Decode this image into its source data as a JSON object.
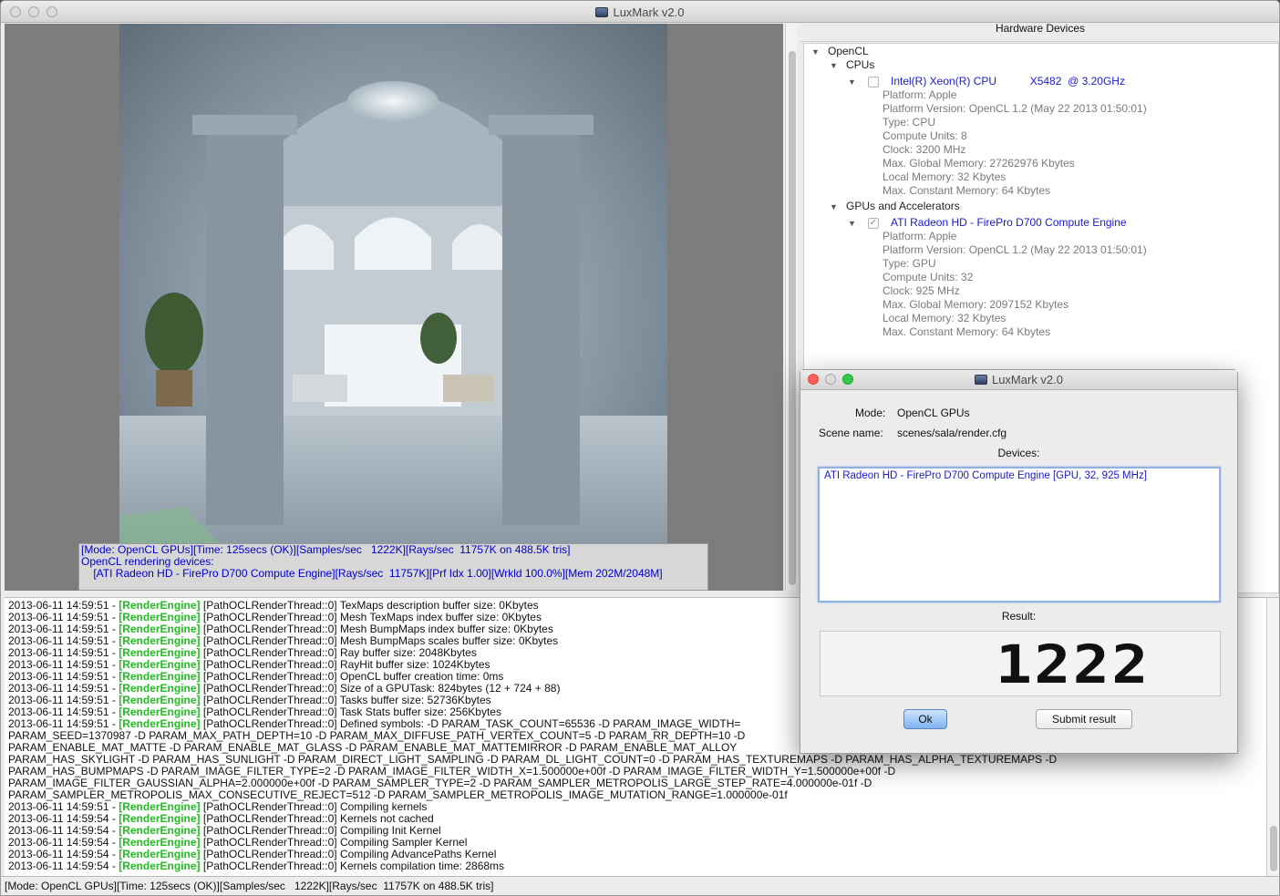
{
  "window": {
    "title": "LuxMark v2.0"
  },
  "render": {
    "overlay_line1": "[Mode: OpenCL GPUs][Time: 125secs (OK)][Samples/sec   1222K][Rays/sec  11757K on 488.5K tris]",
    "overlay_line2": "",
    "overlay_line3": "OpenCL rendering devices:",
    "overlay_line4": "    [ATI Radeon HD - FirePro D700 Compute Engine][Rays/sec  11757K][Prf Idx 1.00][Wrkld 100.0%][Mem 202M/2048M]"
  },
  "hardware": {
    "header": "Hardware Devices",
    "opencl": "OpenCL",
    "cpus": "CPUs",
    "cpu_device": {
      "name": "Intel(R) Xeon(R) CPU           X5482  @ 3.20GHz",
      "checked": false,
      "info": [
        "Platform: Apple",
        "Platform Version: OpenCL 1.2 (May 22 2013 01:50:01)",
        "Type: CPU",
        "Compute Units: 8",
        "Clock: 3200 MHz",
        "Max. Global Memory: 27262976 Kbytes",
        "Local Memory: 32 Kbytes",
        "Max. Constant Memory: 64 Kbytes"
      ]
    },
    "gpus": "GPUs and Accelerators",
    "gpu_device": {
      "name": "ATI Radeon HD - FirePro D700 Compute Engine",
      "checked": true,
      "info": [
        "Platform: Apple",
        "Platform Version: OpenCL 1.2 (May 22 2013 01:50:01)",
        "Type: GPU",
        "Compute Units: 32",
        "Clock: 925 MHz",
        "Max. Global Memory: 2097152 Kbytes",
        "Local Memory: 32 Kbytes",
        "Max. Constant Memory: 64 Kbytes"
      ]
    }
  },
  "log": [
    {
      "ts": "2013-06-11 14:59:51 - ",
      "tag": "[RenderEngine]",
      "msg": " [PathOCLRenderThread::0] TexMaps description buffer size: 0Kbytes"
    },
    {
      "ts": "2013-06-11 14:59:51 - ",
      "tag": "[RenderEngine]",
      "msg": " [PathOCLRenderThread::0] Mesh TexMaps index buffer size: 0Kbytes"
    },
    {
      "ts": "2013-06-11 14:59:51 - ",
      "tag": "[RenderEngine]",
      "msg": " [PathOCLRenderThread::0] Mesh BumpMaps index buffer size: 0Kbytes"
    },
    {
      "ts": "2013-06-11 14:59:51 - ",
      "tag": "[RenderEngine]",
      "msg": " [PathOCLRenderThread::0] Mesh BumpMaps scales buffer size: 0Kbytes"
    },
    {
      "ts": "2013-06-11 14:59:51 - ",
      "tag": "[RenderEngine]",
      "msg": " [PathOCLRenderThread::0] Ray buffer size: 2048Kbytes"
    },
    {
      "ts": "2013-06-11 14:59:51 - ",
      "tag": "[RenderEngine]",
      "msg": " [PathOCLRenderThread::0] RayHit buffer size: 1024Kbytes"
    },
    {
      "ts": "2013-06-11 14:59:51 - ",
      "tag": "[RenderEngine]",
      "msg": " [PathOCLRenderThread::0] OpenCL buffer creation time: 0ms"
    },
    {
      "ts": "2013-06-11 14:59:51 - ",
      "tag": "[RenderEngine]",
      "msg": " [PathOCLRenderThread::0] Size of a GPUTask: 824bytes (12 + 724 + 88)"
    },
    {
      "ts": "2013-06-11 14:59:51 - ",
      "tag": "[RenderEngine]",
      "msg": " [PathOCLRenderThread::0] Tasks buffer size: 52736Kbytes"
    },
    {
      "ts": "2013-06-11 14:59:51 - ",
      "tag": "[RenderEngine]",
      "msg": " [PathOCLRenderThread::0] Task Stats buffer size: 256Kbytes"
    },
    {
      "ts": "2013-06-11 14:59:51 - ",
      "tag": "[RenderEngine]",
      "msg": " [PathOCLRenderThread::0] Defined symbols: -D PARAM_TASK_COUNT=65536 -D PARAM_IMAGE_WIDTH=                                                                                    -D"
    },
    {
      "ts": "PARAM_SEED=1370987 -D PARAM_MAX_PATH_DEPTH=10 -D PARAM_MAX_DIFFUSE_PATH_VERTEX_COUNT=5 -D PARAM_RR_DEPTH=10 -D",
      "tag": "",
      "msg": ""
    },
    {
      "ts": "PARAM_ENABLE_MAT_MATTE -D PARAM_ENABLE_MAT_GLASS -D PARAM_ENABLE_MAT_MATTEMIRROR -D PARAM_ENABLE_MAT_ALLOY",
      "tag": "",
      "msg": ""
    },
    {
      "ts": "PARAM_HAS_SKYLIGHT -D PARAM_HAS_SUNLIGHT -D PARAM_DIRECT_LIGHT_SAMPLING -D PARAM_DL_LIGHT_COUNT=0 -D PARAM_HAS_TEXTUREMAPS -D PARAM_HAS_ALPHA_TEXTUREMAPS -D",
      "tag": "",
      "msg": ""
    },
    {
      "ts": "PARAM_HAS_BUMPMAPS -D PARAM_IMAGE_FILTER_TYPE=2 -D PARAM_IMAGE_FILTER_WIDTH_X=1.500000e+00f -D PARAM_IMAGE_FILTER_WIDTH_Y=1.500000e+00f -D",
      "tag": "",
      "msg": ""
    },
    {
      "ts": "PARAM_IMAGE_FILTER_GAUSSIAN_ALPHA=2.000000e+00f -D PARAM_SAMPLER_TYPE=2 -D PARAM_SAMPLER_METROPOLIS_LARGE_STEP_RATE=4.000000e-01f -D",
      "tag": "",
      "msg": ""
    },
    {
      "ts": "PARAM_SAMPLER_METROPOLIS_MAX_CONSECUTIVE_REJECT=512 -D PARAM_SAMPLER_METROPOLIS_IMAGE_MUTATION_RANGE=1.000000e-01f",
      "tag": "",
      "msg": ""
    },
    {
      "ts": "2013-06-11 14:59:51 - ",
      "tag": "[RenderEngine]",
      "msg": " [PathOCLRenderThread::0] Compiling kernels"
    },
    {
      "ts": "2013-06-11 14:59:54 - ",
      "tag": "[RenderEngine]",
      "msg": " [PathOCLRenderThread::0] Kernels not cached"
    },
    {
      "ts": "2013-06-11 14:59:54 - ",
      "tag": "[RenderEngine]",
      "msg": " [PathOCLRenderThread::0] Compiling Init Kernel"
    },
    {
      "ts": "2013-06-11 14:59:54 - ",
      "tag": "[RenderEngine]",
      "msg": " [PathOCLRenderThread::0] Compiling Sampler Kernel"
    },
    {
      "ts": "2013-06-11 14:59:54 - ",
      "tag": "[RenderEngine]",
      "msg": " [PathOCLRenderThread::0] Compiling AdvancePaths Kernel"
    },
    {
      "ts": "2013-06-11 14:59:54 - ",
      "tag": "[RenderEngine]",
      "msg": " [PathOCLRenderThread::0] Kernels compilation time: 2868ms"
    }
  ],
  "status_bar": "[Mode: OpenCL GPUs][Time: 125secs (OK)][Samples/sec   1222K][Rays/sec  11757K on 488.5K tris]",
  "dialog": {
    "title": "LuxMark v2.0",
    "mode_label": "Mode:",
    "mode_value": "OpenCL GPUs",
    "scene_label": "Scene name:",
    "scene_value": "scenes/sala/render.cfg",
    "devices_label": "Devices:",
    "devices": [
      "ATI Radeon HD - FirePro D700 Compute Engine [GPU, 32, 925 MHz]"
    ],
    "result_label": "Result:",
    "result_value": "1222",
    "ok_label": "Ok",
    "submit_label": "Submit result"
  },
  "colors": {
    "log_tag": "#22bb22",
    "device_text": "#1a1acc",
    "info_text": "#7a7a7a"
  }
}
